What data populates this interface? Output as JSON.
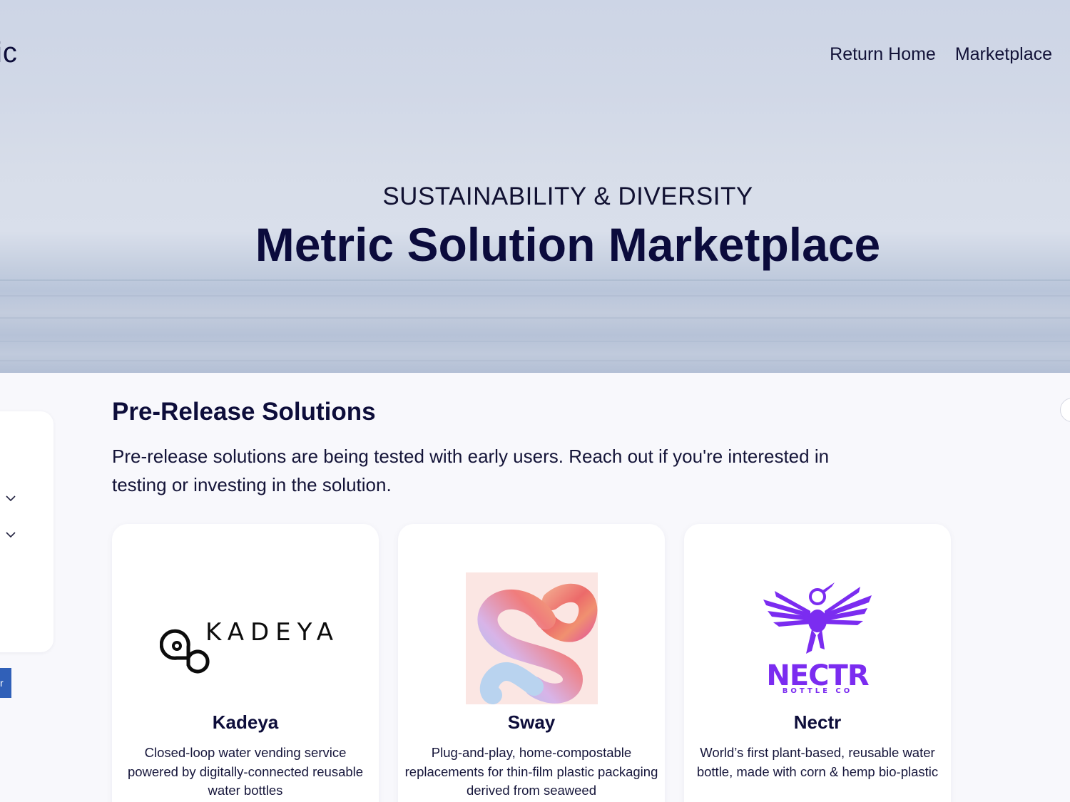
{
  "header": {
    "logo_fragment": "ic",
    "nav": [
      "Return Home",
      "Marketplace"
    ]
  },
  "hero": {
    "kicker": "SUSTAINABILITY & DIVERSITY",
    "title": "Metric Solution Marketplace"
  },
  "sidebar": {
    "tab_fragment": "r"
  },
  "section": {
    "title": "Pre-Release Solutions",
    "description": "Pre-release solutions are being tested with early users. Reach out if you're interested in testing or investing in the solution."
  },
  "cards": [
    {
      "name": "Kadeya",
      "logo_text": "KADEYA",
      "description": "Closed-loop water vending service powered by digitally-connected reusable water bottles"
    },
    {
      "name": "Sway",
      "description": "Plug-and-play, home-compostable replacements for thin-film plastic packaging derived from seaweed"
    },
    {
      "name": "Nectr",
      "logo_text": "NECTR",
      "logo_subtext": "BOTTLE CO",
      "description": "World’s first plant-based, reusable water bottle, made with corn & hemp bio-plastic"
    }
  ],
  "colors": {
    "text_dark": "#0d0d3a",
    "nectr_purple": "#7b2cf0",
    "side_tab_blue": "#3060b8"
  }
}
